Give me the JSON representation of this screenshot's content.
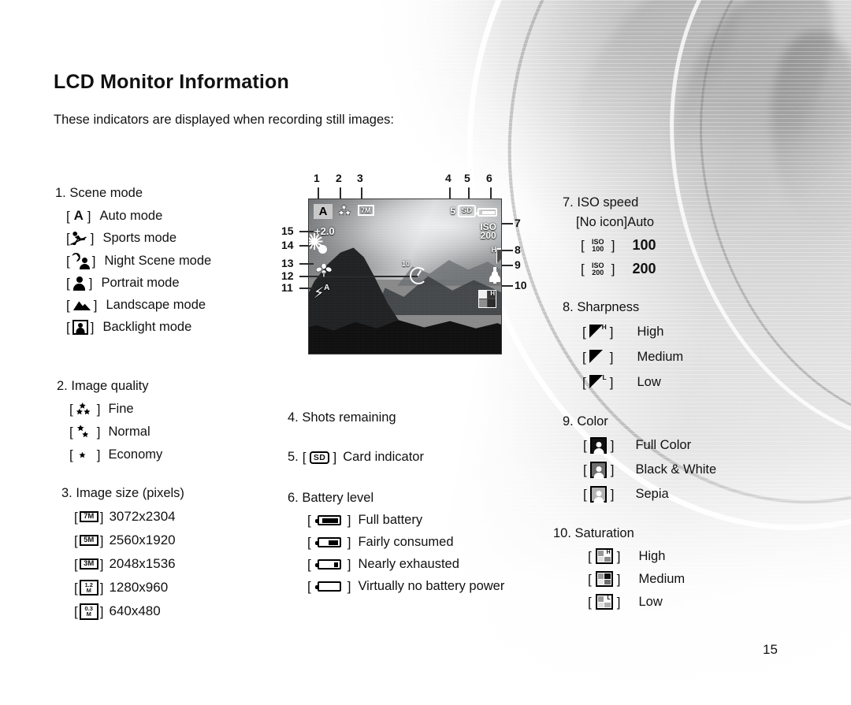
{
  "page": {
    "title": "LCD Monitor Information",
    "subtitle": "These indicators are displayed when recording still images:",
    "page_number": "15"
  },
  "sections": {
    "scene_mode": {
      "number": "1.",
      "heading": "Scene mode",
      "items": [
        {
          "icon": "auto-A-icon",
          "label": "Auto mode"
        },
        {
          "icon": "sports-icon",
          "label": "Sports mode"
        },
        {
          "icon": "night-scene-icon",
          "label": "Night Scene mode"
        },
        {
          "icon": "portrait-icon",
          "label": "Portrait mode"
        },
        {
          "icon": "landscape-icon",
          "label": "Landscape mode"
        },
        {
          "icon": "backlight-icon",
          "label": "Backlight mode"
        }
      ]
    },
    "image_quality": {
      "number": "2.",
      "heading": "Image quality",
      "items": [
        {
          "icon": "three-star-icon",
          "label": "Fine"
        },
        {
          "icon": "two-star-icon",
          "label": "Normal"
        },
        {
          "icon": "one-star-icon",
          "label": "Economy"
        }
      ]
    },
    "image_size": {
      "number": "3.",
      "heading": "Image size (pixels)",
      "items": [
        {
          "icon": "7M",
          "icon_sub": "",
          "label": "3072x2304"
        },
        {
          "icon": "5M",
          "icon_sub": "",
          "label": "2560x1920"
        },
        {
          "icon": "3M",
          "icon_sub": "",
          "label": "2048x1536"
        },
        {
          "icon": "1.2",
          "icon_sub": "M",
          "label": "1280x960"
        },
        {
          "icon": "0.3",
          "icon_sub": "M",
          "label": "640x480"
        }
      ]
    },
    "shots_remaining": {
      "number": "4.",
      "heading": "Shots remaining"
    },
    "card_indicator": {
      "number": "5.",
      "icon": "SD",
      "label": "Card indicator"
    },
    "battery_level": {
      "number": "6.",
      "heading": "Battery level",
      "items": [
        {
          "icon": "battery-full-icon",
          "fill": 78,
          "label": "Full battery"
        },
        {
          "icon": "battery-half-icon",
          "fill": 48,
          "label": "Fairly consumed"
        },
        {
          "icon": "battery-low-icon",
          "fill": 22,
          "label": "Nearly exhausted"
        },
        {
          "icon": "battery-empty-icon",
          "fill": 0,
          "label": "Virtually no battery power"
        }
      ]
    },
    "iso_speed": {
      "number": "7.",
      "heading": "ISO speed",
      "auto_icon_text": "[No icon]",
      "auto_label": "Auto",
      "items": [
        {
          "icon_top": "ISO",
          "icon_bottom": "100",
          "value": "100"
        },
        {
          "icon_top": "ISO",
          "icon_bottom": "200",
          "value": "200"
        }
      ]
    },
    "sharpness": {
      "number": "8.",
      "heading": "Sharpness",
      "items": [
        {
          "icon": "sharpness-high-icon",
          "sup": "H",
          "value": "High"
        },
        {
          "icon": "sharpness-medium-icon",
          "sup": "",
          "value": "Medium"
        },
        {
          "icon": "sharpness-low-icon",
          "sup": "L",
          "value": "Low"
        }
      ]
    },
    "color": {
      "number": "9.",
      "heading": "Color",
      "items": [
        {
          "icon": "color-full-icon",
          "bg": "#111111",
          "value": "Full Color"
        },
        {
          "icon": "color-bw-icon",
          "bg": "#6e6e6e",
          "value": "Black & White"
        },
        {
          "icon": "color-sepia-icon",
          "bg": "#b4b4b4",
          "value": "Sepia"
        }
      ]
    },
    "saturation": {
      "number": "10.",
      "heading": "Saturation",
      "items": [
        {
          "icon": "saturation-high-icon",
          "letter": "H",
          "value": "High"
        },
        {
          "icon": "saturation-medium-icon",
          "letter": "",
          "value": "Medium"
        },
        {
          "icon": "saturation-low-icon",
          "letter": "L",
          "value": "Low"
        }
      ]
    }
  },
  "lcd": {
    "scene_mode_icon": "A",
    "quality_icon": "three-star-icon",
    "size_icon": "7M",
    "shots_remaining": "5",
    "card_icon": "SD",
    "battery_icon": "battery-full-icon",
    "exposure_compensation": "+2.0",
    "white_balance_icon": "daylight-sun-icon",
    "iso_top": "ISO",
    "iso_bottom": "200",
    "sharpness_sup": "H",
    "macro_icon": "macro-flower-icon",
    "flash_icon": "flash-auto-icon",
    "flash_text": "A",
    "self_timer_seconds": "10",
    "saturation_letter": "H",
    "callouts": [
      "1",
      "2",
      "3",
      "4",
      "5",
      "6",
      "7",
      "8",
      "9",
      "10",
      "11",
      "12",
      "13",
      "14",
      "15"
    ]
  }
}
